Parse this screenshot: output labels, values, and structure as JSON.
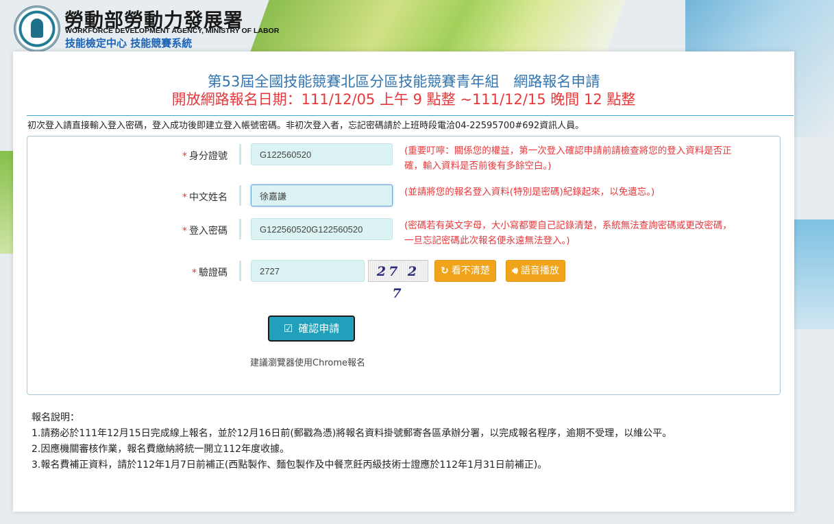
{
  "header": {
    "agency_zh": "勞動部勞動力發展署",
    "agency_en": "WORKFORCE DEVELOPMENT AGENCY, MINISTRY OF LABOR",
    "system_name": "技能檢定中心 技能競賽系統"
  },
  "page": {
    "title": "第53屆全國技能競賽北區分區技能競賽青年組　網路報名申請",
    "subtitle": "開放網路報名日期：111/12/05 上午 9 點整 ~111/12/15 晚間 12 點整",
    "notice": "初次登入請直接輸入登入密碼，登入成功後即建立登入帳號密碼。非初次登入者，忘記密碼請於上班時段電洽04-22595700#692資訊人員。"
  },
  "form": {
    "required_mark": "*",
    "id_label": "身分證號",
    "id_value": "G122560520",
    "id_hint": "(重要叮嚀：關係您的權益，第一次登入確認申請前請檢查將您的登入資料是否正確，輸入資料是否前後有多餘空白。)",
    "name_label": "中文姓名",
    "name_value": "徐嘉謙",
    "name_hint": "(並請將您的報名登入資料(特別是密碼)紀錄起來，以免遺忘。)",
    "password_label": "登入密碼",
    "password_value": "G122560520G122560520",
    "password_hint": "(密碼若有英文字母，大小寫都要自己記錄清楚，系統無法查詢密碼或更改密碼，一旦忘記密碼此次報名便永遠無法登入。)",
    "captcha_label": "驗證碼",
    "captcha_value": "2727",
    "captcha_image_text": "27 2 7",
    "refresh_label": "看不清楚",
    "audio_label": "語音播放",
    "submit_label": "確認申請",
    "browser_tip": "建議瀏覽器使用Chrome報名"
  },
  "info": {
    "heading": "報名說明：",
    "items": [
      "1.請務必於111年12月15日完成線上報名，並於12月16日前(郵戳為憑)將報名資料掛號郵寄各區承辦分署，以完成報名程序，逾期不受理，以維公平。",
      "2.因應機關審核作業，報名費繳納將統一開立112年度收據。",
      "3.報名費補正資料，請於112年1月7日前補正(西點製作、麵包製作及中餐烹飪丙級技術士證應於112年1月31日前補正)。"
    ]
  },
  "icons": {
    "refresh": "refresh-icon",
    "audio": "volume-icon",
    "submit": "check-square-icon"
  },
  "colors": {
    "title_blue": "#3275b0",
    "alert_red": "#e8373a",
    "button_orange": "#f0a41a",
    "submit_teal": "#20a0ba"
  }
}
